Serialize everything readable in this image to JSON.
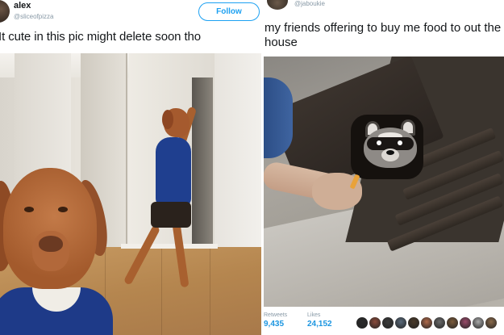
{
  "left_tweet": {
    "name": "alex",
    "handle": "@sliceofpizza",
    "follow_label": "Follow",
    "caption": "It cute in this pic might delete soon tho"
  },
  "right_tweet": {
    "handle": "@jaboukie",
    "caption": "my friends offering to buy me food to out the house",
    "stats": {
      "retweets_label": "Retweets",
      "retweets_value": "9,435",
      "likes_label": "Likes",
      "likes_value": "24,152"
    },
    "liker_colors": [
      "#2a2a2a",
      "#8a4a3a",
      "#3a3a3a",
      "#5a6a7a",
      "#4a3a2a",
      "#b06a4a",
      "#6a6a6a",
      "#7a5a3a",
      "#9a4a6a",
      "#aaaaaa",
      "#8a6a4a"
    ]
  },
  "colors": {
    "accent": "#1da1f2",
    "text": "#14171a",
    "muted": "#8899a6",
    "stat_value": "#1b95e0"
  }
}
